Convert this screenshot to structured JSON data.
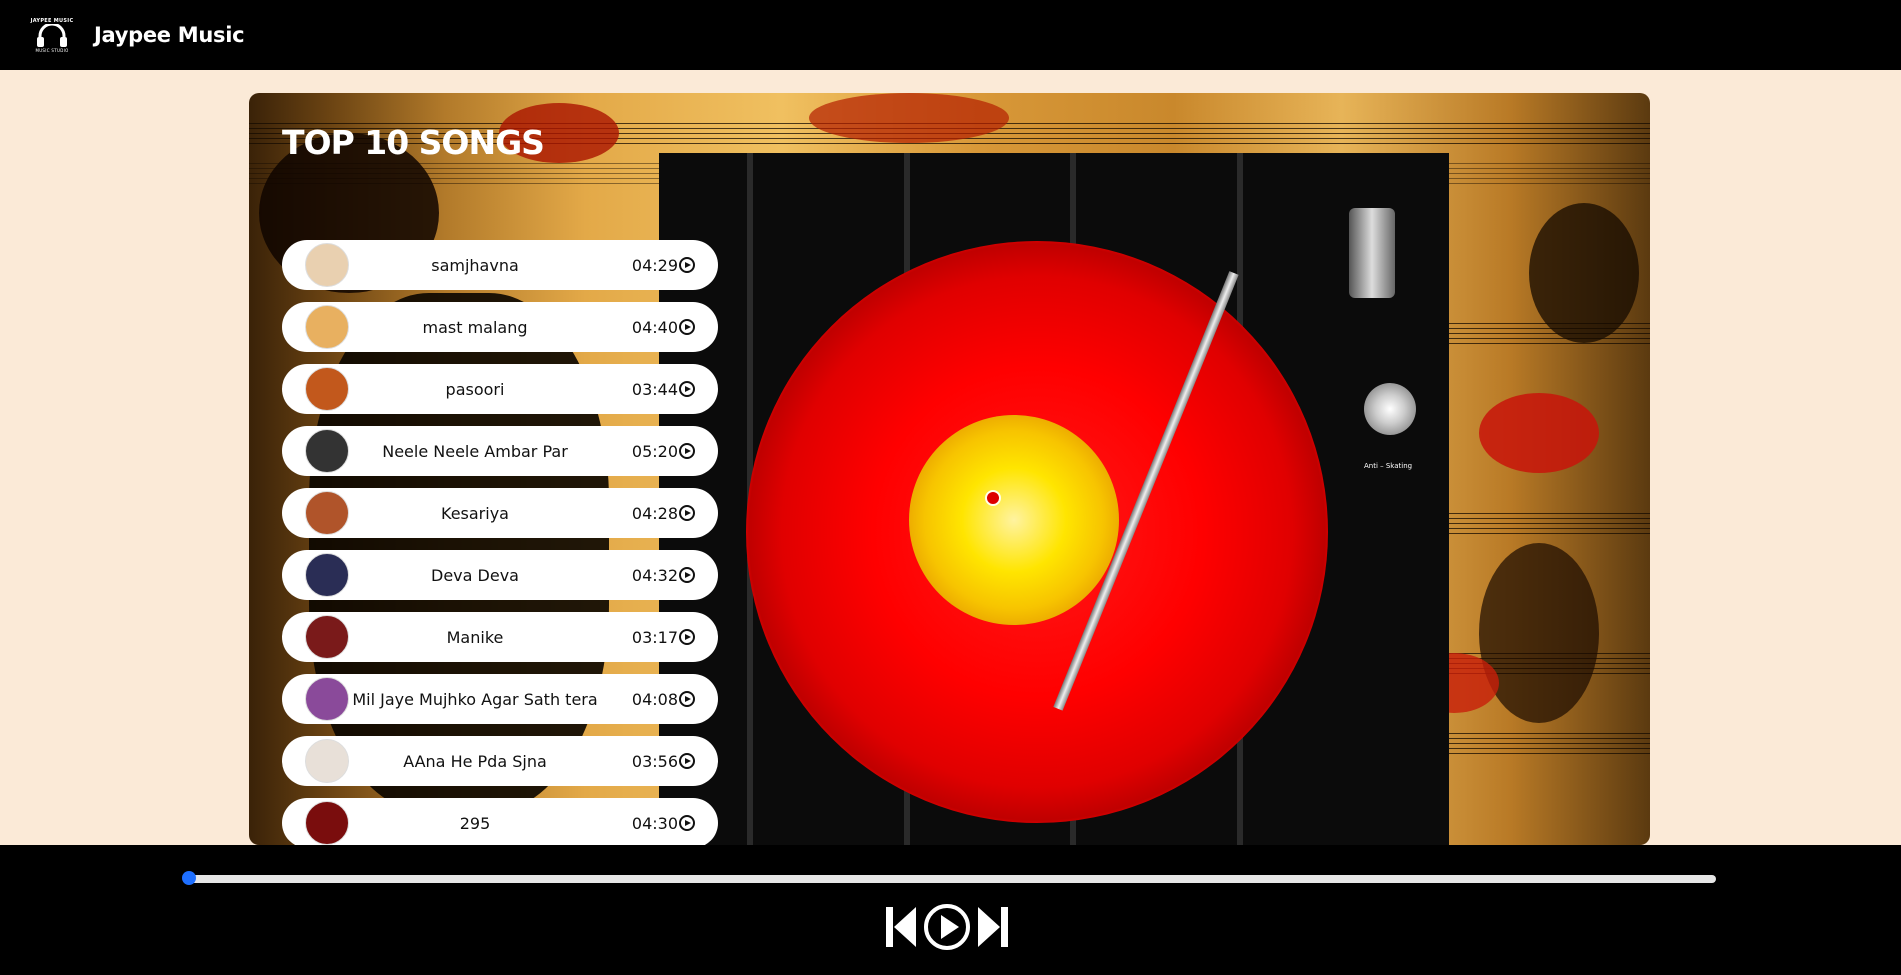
{
  "navbar": {
    "logo_text": "JAYPEE MUSIC",
    "logo_sub": "MUSIC STUDIO",
    "brand": "Jaypee Music"
  },
  "main": {
    "title": "TOP 10 SONGS",
    "turntable_label": "Anti – Skating",
    "songs": [
      {
        "name": "samjhavna",
        "duration": "04:29",
        "thumb_color": "#e9d0b0"
      },
      {
        "name": "mast malang",
        "duration": "04:40",
        "thumb_color": "#e8b060"
      },
      {
        "name": "pasoori",
        "duration": "03:44",
        "thumb_color": "#c2581c"
      },
      {
        "name": "Neele Neele Ambar Par",
        "duration": "05:20",
        "thumb_color": "#333333"
      },
      {
        "name": "Kesariya",
        "duration": "04:28",
        "thumb_color": "#b0542a"
      },
      {
        "name": "Deva Deva",
        "duration": "04:32",
        "thumb_color": "#2a2d55"
      },
      {
        "name": "Manike",
        "duration": "03:17",
        "thumb_color": "#7a1a1a"
      },
      {
        "name": "Mil Jaye Mujhko Agar Sath tera",
        "duration": "04:08",
        "thumb_color": "#8a4a9a"
      },
      {
        "name": "AAna He Pda Sjna",
        "duration": "03:56",
        "thumb_color": "#e8e0d8"
      },
      {
        "name": "295",
        "duration": "04:30",
        "thumb_color": "#7a0d0d"
      }
    ]
  },
  "player": {
    "progress": 0,
    "icons": [
      "previous-icon",
      "play-icon",
      "next-icon"
    ],
    "accent": "#1e6fff"
  }
}
